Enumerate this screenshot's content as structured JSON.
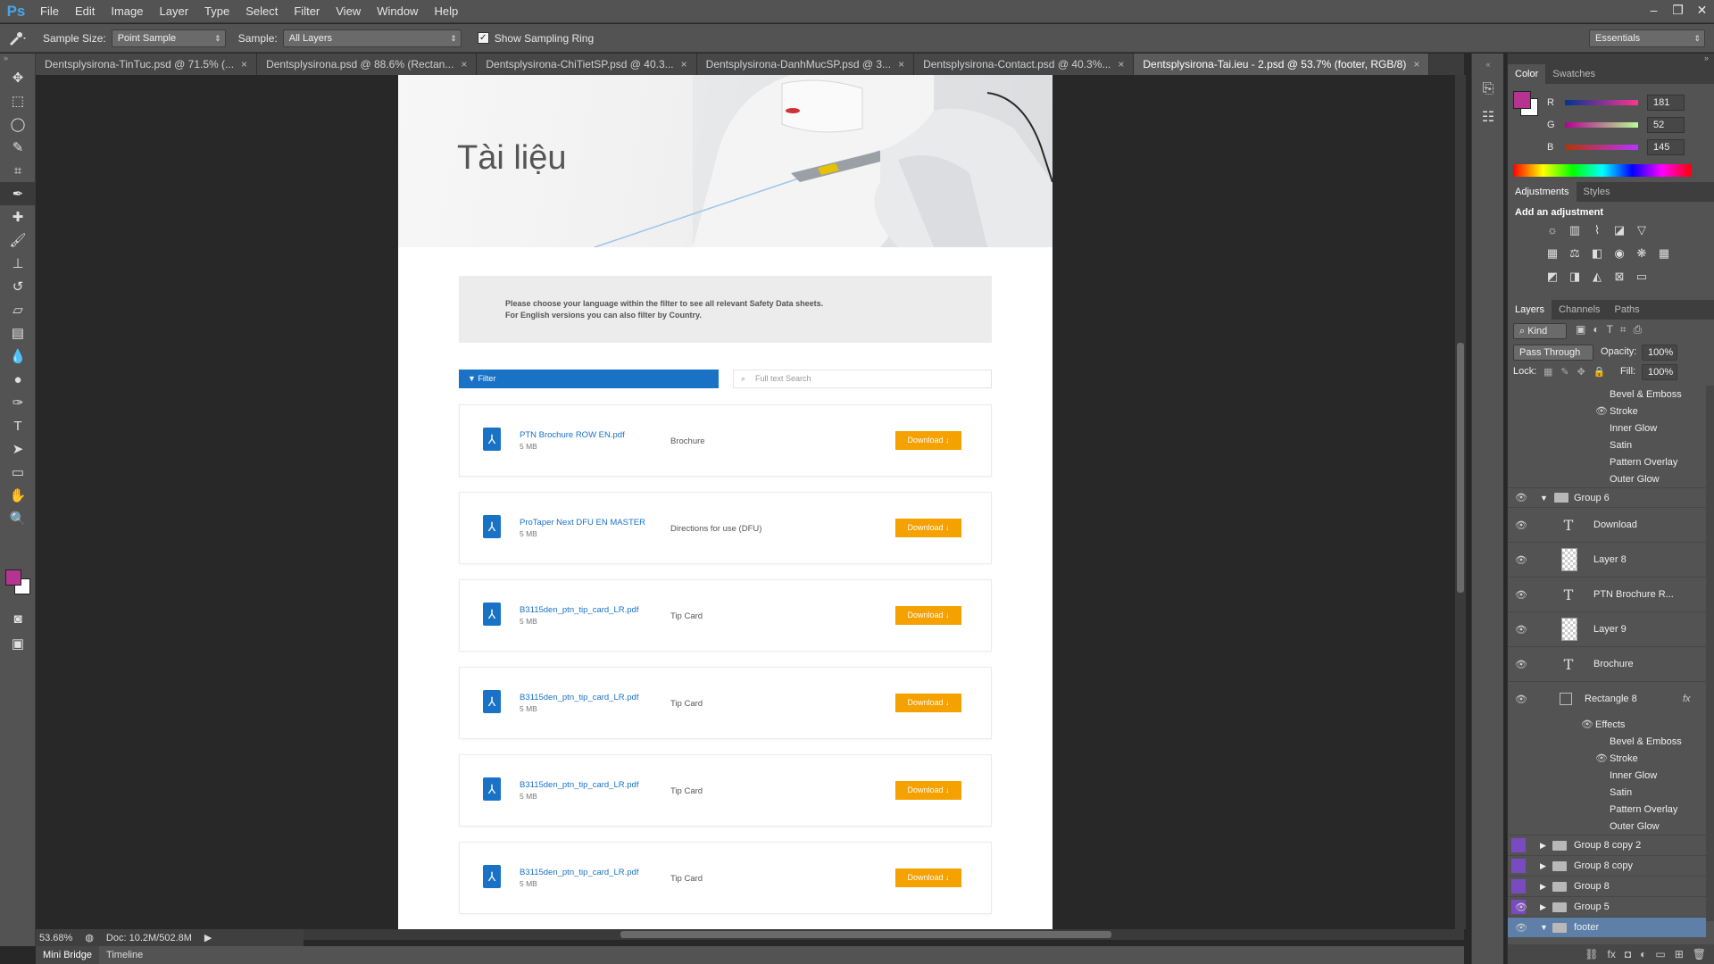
{
  "app": {
    "logo": "Ps",
    "title": "Adobe Photoshop"
  },
  "menu": [
    "File",
    "Edit",
    "Image",
    "Layer",
    "Type",
    "Select",
    "Filter",
    "View",
    "Window",
    "Help"
  ],
  "window_controls": [
    "–",
    "❐",
    "✕"
  ],
  "options": {
    "sample_size_label": "Sample Size:",
    "sample_size_value": "Point Sample",
    "sample_label": "Sample:",
    "sample_value": "All Layers",
    "sampling_ring_label": "Show Sampling Ring",
    "sampling_ring_checked": true,
    "workspace": "Essentials"
  },
  "tabs": [
    {
      "label": "Dentsplysirona-TinTuc.psd @ 71.5% (...",
      "active": false
    },
    {
      "label": "Dentsplysirona.psd @ 88.6% (Rectan...",
      "active": false
    },
    {
      "label": "Dentsplysirona-ChiTietSP.psd @ 40.3...",
      "active": false
    },
    {
      "label": "Dentsplysirona-DanhMucSP.psd @ 3...",
      "active": false
    },
    {
      "label": "Dentsplysirona-Contact.psd @ 40.3%...",
      "active": false
    },
    {
      "label": "Dentsplysirona-Tai.ieu - 2.psd @ 53.7% (footer, RGB/8)",
      "active": true
    }
  ],
  "doc": {
    "hero_title": "Tài liệu",
    "notice_line1": "Please choose your language within the filter to see all relevant Safety Data sheets.",
    "notice_line2": "For English versions you can also filter by Country.",
    "filter_label": "Filter",
    "search_placeholder": "Full text Search",
    "files": [
      {
        "name": "PTN Brochure ROW EN.pdf",
        "size": "5 MB",
        "type": "Brochure",
        "button": "Download"
      },
      {
        "name": "ProTaper Next DFU EN MASTER",
        "size": "5 MB",
        "type": "Directions for use (DFU)",
        "button": "Download"
      },
      {
        "name": "B3115den_ptn_tip_card_LR.pdf",
        "size": "5 MB",
        "type": "Tip Card",
        "button": "Download"
      },
      {
        "name": "B3115den_ptn_tip_card_LR.pdf",
        "size": "5 MB",
        "type": "Tip Card",
        "button": "Download"
      },
      {
        "name": "B3115den_ptn_tip_card_LR.pdf",
        "size": "5 MB",
        "type": "Tip Card",
        "button": "Download"
      },
      {
        "name": "B3115den_ptn_tip_card_LR.pdf",
        "size": "5 MB",
        "type": "Tip Card",
        "button": "Download"
      }
    ],
    "accent_blue": "#1a72c7",
    "accent_orange": "#f5a100"
  },
  "status": {
    "zoom": "53.68%",
    "doc_size": "Doc: 10.2M/502.8M"
  },
  "bottom_tabs": [
    "Mini Bridge",
    "Timeline"
  ],
  "color_panel": {
    "tabs": [
      "Color",
      "Swatches"
    ],
    "r_label": "R",
    "g_label": "G",
    "b_label": "B",
    "r": "181",
    "g": "52",
    "b": "145",
    "foreground": "#b53491"
  },
  "adjust_panel": {
    "tabs": [
      "Adjustments",
      "Styles"
    ],
    "title": "Add an adjustment"
  },
  "layers_panel": {
    "tabs": [
      "Layers",
      "Channels",
      "Paths"
    ],
    "kind": "Kind",
    "blend_mode": "Pass Through",
    "opacity_label": "Opacity:",
    "opacity": "100%",
    "lock_label": "Lock:",
    "fill_label": "Fill:",
    "fill": "100%",
    "effects_top": [
      "Bevel & Emboss",
      "Stroke",
      "Inner Glow",
      "Satin",
      "Pattern Overlay",
      "Outer Glow"
    ],
    "group6": "Group 6",
    "layer_download": "Download",
    "layer8": "Layer 8",
    "layer_ptn": "PTN Brochure R...",
    "layer9": "Layer 9",
    "layer_brochure": "Brochure",
    "rect8": "Rectangle 8",
    "effects_label": "Effects",
    "effects_bottom": [
      "Bevel & Emboss",
      "Stroke",
      "Inner Glow",
      "Satin",
      "Pattern Overlay",
      "Outer Glow"
    ],
    "groups": [
      "Group 8 copy 2",
      "Group 8 copy",
      "Group 8",
      "Group 5",
      "footer"
    ]
  }
}
